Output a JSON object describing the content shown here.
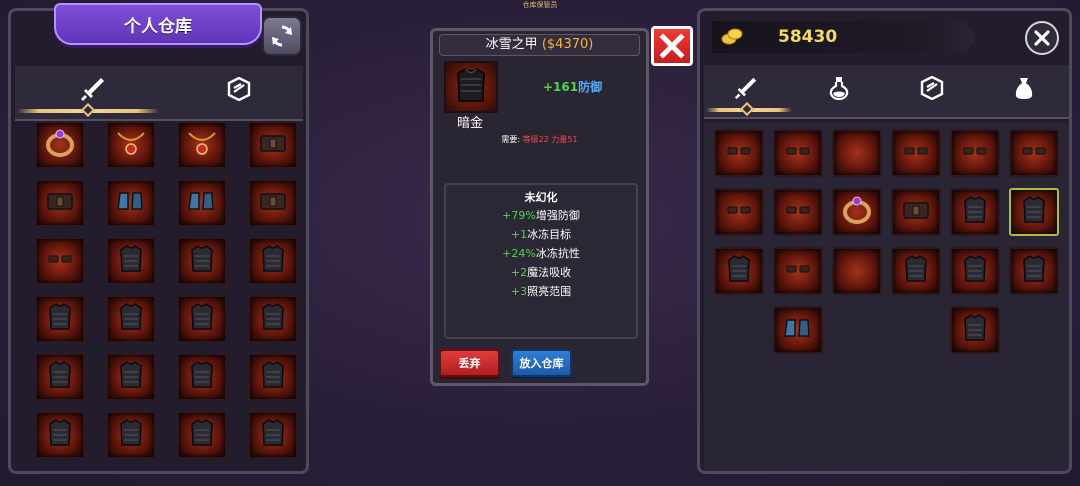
{
  "top_caption": "仓库保管员",
  "left_panel": {
    "title": "个人仓库",
    "tabs": [
      {
        "name": "weapon",
        "icon": "sword-icon",
        "active": true
      },
      {
        "name": "armor",
        "icon": "armor-icon",
        "active": false
      }
    ],
    "items": [
      {
        "icon": "ring-icon"
      },
      {
        "icon": "amulet-icon"
      },
      {
        "icon": "amulet-icon"
      },
      {
        "icon": "belt-icon"
      },
      {
        "icon": "belt-icon"
      },
      {
        "icon": "boots-icon"
      },
      {
        "icon": "boots-icon"
      },
      {
        "icon": "belt-icon"
      },
      {
        "icon": "gloves-icon"
      },
      {
        "icon": "armor-icon"
      },
      {
        "icon": "armor-icon"
      },
      {
        "icon": "armor-icon"
      },
      {
        "icon": "armor-icon"
      },
      {
        "icon": "armor-icon"
      },
      {
        "icon": "armor-icon"
      },
      {
        "icon": "armor-icon"
      },
      {
        "icon": "armor-icon"
      },
      {
        "icon": "armor-icon"
      },
      {
        "icon": "armor-icon"
      },
      {
        "icon": "armor-icon"
      },
      {
        "icon": "armor-icon"
      },
      {
        "icon": "armor-icon"
      },
      {
        "icon": "armor-icon"
      },
      {
        "icon": "armor-icon"
      }
    ]
  },
  "tooltip": {
    "name": "冰雪之甲",
    "price": "($4370)",
    "defense_value": "+161",
    "defense_label": "防御",
    "grade": "暗金",
    "requirement_prefix": "需要:",
    "requirement_values": "等级22 力量51",
    "affix_header": "未幻化",
    "affixes": [
      {
        "value": "+79%",
        "label": "增强防御"
      },
      {
        "value": "+1",
        "label": "冰冻目标"
      },
      {
        "value": "+24%",
        "label": "冰冻抗性"
      },
      {
        "value": "+2",
        "label": "魔法吸收"
      },
      {
        "value": "+3",
        "label": "照亮范围"
      }
    ],
    "discard_label": "丢弃",
    "store_label": "放入仓库"
  },
  "right_panel": {
    "gold": "58430",
    "tabs": [
      {
        "name": "weapon",
        "icon": "sword-icon",
        "active": true
      },
      {
        "name": "potion",
        "icon": "potion-icon",
        "active": false
      },
      {
        "name": "armor",
        "icon": "armor-icon",
        "active": false
      },
      {
        "name": "bag",
        "icon": "bag-icon",
        "active": false
      }
    ],
    "items": [
      {
        "icon": "gloves-icon"
      },
      {
        "icon": "gloves-icon"
      },
      {
        "icon": "empty"
      },
      {
        "icon": "gloves-icon"
      },
      {
        "icon": "gloves-icon"
      },
      {
        "icon": "gloves-icon"
      },
      {
        "icon": "gloves-icon"
      },
      {
        "icon": "gloves-icon"
      },
      {
        "icon": "ring-icon"
      },
      {
        "icon": "belt-icon"
      },
      {
        "icon": "armor-icon"
      },
      {
        "icon": "armor-icon",
        "selected": true
      },
      {
        "icon": "armor-icon"
      },
      {
        "icon": "gloves-icon"
      },
      {
        "icon": "empty"
      },
      {
        "icon": "armor-icon"
      },
      {
        "icon": "armor-icon"
      },
      {
        "icon": "armor-icon"
      },
      {
        "icon": "empty-slot"
      },
      {
        "icon": "boots-icon"
      },
      {
        "icon": "empty-slot"
      },
      {
        "icon": "empty-slot"
      },
      {
        "icon": "armor-icon"
      },
      {
        "icon": "empty-slot"
      }
    ]
  },
  "colors": {
    "accent_purple": "#7e4fd8",
    "gold_text": "#f2dc5a",
    "price": "#f2b441",
    "stat_green": "#49d84b",
    "stat_blue": "#56a8f2",
    "requirement_red": "#f14b4b",
    "discard_red": "#e23b3b",
    "store_blue": "#2e7fd8",
    "selection_border": "#a6c23c"
  }
}
